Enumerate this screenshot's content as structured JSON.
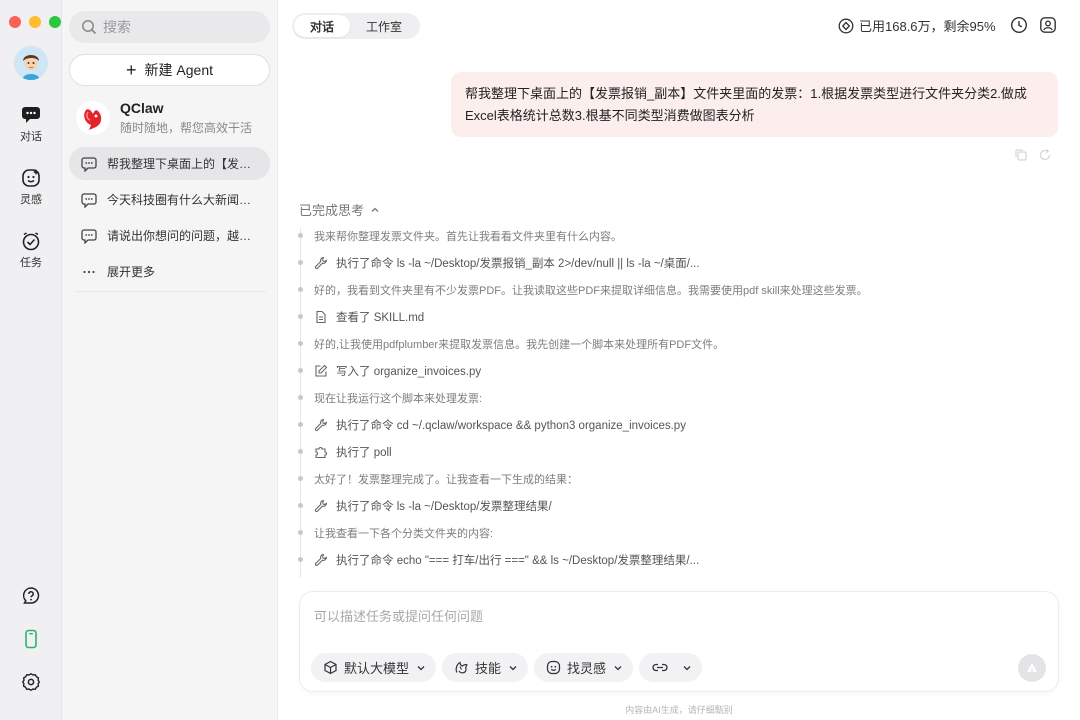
{
  "window": {
    "traffic_colors": [
      "#fe5f57",
      "#febc2e",
      "#28c840"
    ]
  },
  "rail": {
    "items": [
      {
        "label": "对话",
        "icon": "chat-icon"
      },
      {
        "label": "灵感",
        "icon": "inspiration-icon"
      },
      {
        "label": "任务",
        "icon": "task-icon"
      }
    ],
    "bottom_icons": [
      "help-icon",
      "phone-icon",
      "settings-icon"
    ],
    "accent": "#2bb36b"
  },
  "sidebar": {
    "search_placeholder": "搜索",
    "new_agent_label": "新建 Agent",
    "agent": {
      "name": "QClaw",
      "subtitle": "随时随地，帮您高效干活"
    },
    "conversations": [
      {
        "title": "帮我整理下桌面上的【发票报销_副本】文件夹里面的发票",
        "active": true
      },
      {
        "title": "今天科技圈有什么大新闻，帮我总结一下",
        "active": false
      },
      {
        "title": "请说出你想问的问题，越具体越好",
        "active": false
      }
    ],
    "more_label": "展开更多"
  },
  "main": {
    "tabs": [
      {
        "label": "对话",
        "active": true
      },
      {
        "label": "工作室",
        "active": false
      }
    ],
    "usage_text": "已用168.6万，剩余95%",
    "user_message": "帮我整理下桌面上的【发票报销_副本】文件夹里面的发票：1.根据发票类型进行文件夹分类2.做成Excel表格统计总数3.根基不同类型消费做图表分析",
    "thinking_label": "已完成思考",
    "steps": [
      {
        "kind": "text",
        "text": "我来帮你整理发票文件夹。首先让我看看文件夹里有什么内容。"
      },
      {
        "kind": "tool",
        "icon": "wrench-icon",
        "text": "执行了命令 ls -la ~/Desktop/发票报销_副本 2>/dev/null || ls -la ~/桌面/..."
      },
      {
        "kind": "text",
        "text": "好的，我看到文件夹里有不少发票PDF。让我读取这些PDF来提取详细信息。我需要使用pdf skill来处理这些发票。"
      },
      {
        "kind": "tool",
        "icon": "document-icon",
        "text": "查看了 SKILL.md"
      },
      {
        "kind": "text",
        "text": "好的,让我使用pdfplumber来提取发票信息。我先创建一个脚本来处理所有PDF文件。"
      },
      {
        "kind": "tool",
        "icon": "edit-icon",
        "text": "写入了 organize_invoices.py"
      },
      {
        "kind": "text",
        "text": "现在让我运行这个脚本来处理发票:"
      },
      {
        "kind": "tool",
        "icon": "wrench-icon",
        "text": "执行了命令 cd ~/.qclaw/workspace && python3 organize_invoices.py"
      },
      {
        "kind": "tool",
        "icon": "puzzle-icon",
        "text": "执行了 poll"
      },
      {
        "kind": "text",
        "text": "太好了！发票整理完成了。让我查看一下生成的结果："
      },
      {
        "kind": "tool",
        "icon": "wrench-icon",
        "text": "执行了命令 ls -la ~/Desktop/发票整理结果/"
      },
      {
        "kind": "text",
        "text": "让我查看一下各个分类文件夹的内容:"
      },
      {
        "kind": "tool",
        "icon": "wrench-icon",
        "text": "执行了命令 echo \"=== 打车/出行 ===\" && ls ~/Desktop/发票整理结果/..."
      }
    ]
  },
  "composer": {
    "placeholder": "可以描述任务或提问任何问题",
    "chips": [
      {
        "label": "默认大模型",
        "icon": "cube-icon"
      },
      {
        "label": "技能",
        "icon": "skill-icon"
      },
      {
        "label": "找灵感",
        "icon": "inspiration-icon"
      },
      {
        "label": "",
        "icon": "link-icon"
      }
    ],
    "footer": "内容由AI生成，请仔细甄别"
  }
}
